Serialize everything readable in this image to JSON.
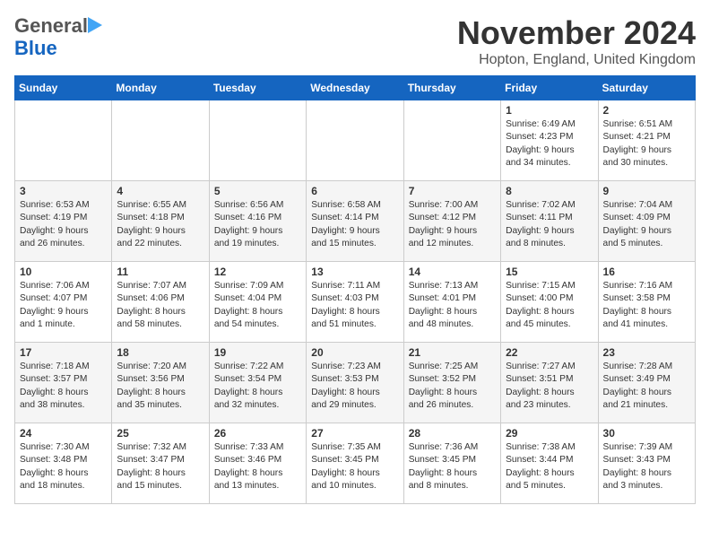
{
  "logo": {
    "general": "General",
    "blue": "Blue"
  },
  "title": "November 2024",
  "location": "Hopton, England, United Kingdom",
  "weekdays": [
    "Sunday",
    "Monday",
    "Tuesday",
    "Wednesday",
    "Thursday",
    "Friday",
    "Saturday"
  ],
  "weeks": [
    [
      {
        "day": "",
        "info": ""
      },
      {
        "day": "",
        "info": ""
      },
      {
        "day": "",
        "info": ""
      },
      {
        "day": "",
        "info": ""
      },
      {
        "day": "",
        "info": ""
      },
      {
        "day": "1",
        "info": "Sunrise: 6:49 AM\nSunset: 4:23 PM\nDaylight: 9 hours\nand 34 minutes."
      },
      {
        "day": "2",
        "info": "Sunrise: 6:51 AM\nSunset: 4:21 PM\nDaylight: 9 hours\nand 30 minutes."
      }
    ],
    [
      {
        "day": "3",
        "info": "Sunrise: 6:53 AM\nSunset: 4:19 PM\nDaylight: 9 hours\nand 26 minutes."
      },
      {
        "day": "4",
        "info": "Sunrise: 6:55 AM\nSunset: 4:18 PM\nDaylight: 9 hours\nand 22 minutes."
      },
      {
        "day": "5",
        "info": "Sunrise: 6:56 AM\nSunset: 4:16 PM\nDaylight: 9 hours\nand 19 minutes."
      },
      {
        "day": "6",
        "info": "Sunrise: 6:58 AM\nSunset: 4:14 PM\nDaylight: 9 hours\nand 15 minutes."
      },
      {
        "day": "7",
        "info": "Sunrise: 7:00 AM\nSunset: 4:12 PM\nDaylight: 9 hours\nand 12 minutes."
      },
      {
        "day": "8",
        "info": "Sunrise: 7:02 AM\nSunset: 4:11 PM\nDaylight: 9 hours\nand 8 minutes."
      },
      {
        "day": "9",
        "info": "Sunrise: 7:04 AM\nSunset: 4:09 PM\nDaylight: 9 hours\nand 5 minutes."
      }
    ],
    [
      {
        "day": "10",
        "info": "Sunrise: 7:06 AM\nSunset: 4:07 PM\nDaylight: 9 hours\nand 1 minute."
      },
      {
        "day": "11",
        "info": "Sunrise: 7:07 AM\nSunset: 4:06 PM\nDaylight: 8 hours\nand 58 minutes."
      },
      {
        "day": "12",
        "info": "Sunrise: 7:09 AM\nSunset: 4:04 PM\nDaylight: 8 hours\nand 54 minutes."
      },
      {
        "day": "13",
        "info": "Sunrise: 7:11 AM\nSunset: 4:03 PM\nDaylight: 8 hours\nand 51 minutes."
      },
      {
        "day": "14",
        "info": "Sunrise: 7:13 AM\nSunset: 4:01 PM\nDaylight: 8 hours\nand 48 minutes."
      },
      {
        "day": "15",
        "info": "Sunrise: 7:15 AM\nSunset: 4:00 PM\nDaylight: 8 hours\nand 45 minutes."
      },
      {
        "day": "16",
        "info": "Sunrise: 7:16 AM\nSunset: 3:58 PM\nDaylight: 8 hours\nand 41 minutes."
      }
    ],
    [
      {
        "day": "17",
        "info": "Sunrise: 7:18 AM\nSunset: 3:57 PM\nDaylight: 8 hours\nand 38 minutes."
      },
      {
        "day": "18",
        "info": "Sunrise: 7:20 AM\nSunset: 3:56 PM\nDaylight: 8 hours\nand 35 minutes."
      },
      {
        "day": "19",
        "info": "Sunrise: 7:22 AM\nSunset: 3:54 PM\nDaylight: 8 hours\nand 32 minutes."
      },
      {
        "day": "20",
        "info": "Sunrise: 7:23 AM\nSunset: 3:53 PM\nDaylight: 8 hours\nand 29 minutes."
      },
      {
        "day": "21",
        "info": "Sunrise: 7:25 AM\nSunset: 3:52 PM\nDaylight: 8 hours\nand 26 minutes."
      },
      {
        "day": "22",
        "info": "Sunrise: 7:27 AM\nSunset: 3:51 PM\nDaylight: 8 hours\nand 23 minutes."
      },
      {
        "day": "23",
        "info": "Sunrise: 7:28 AM\nSunset: 3:49 PM\nDaylight: 8 hours\nand 21 minutes."
      }
    ],
    [
      {
        "day": "24",
        "info": "Sunrise: 7:30 AM\nSunset: 3:48 PM\nDaylight: 8 hours\nand 18 minutes."
      },
      {
        "day": "25",
        "info": "Sunrise: 7:32 AM\nSunset: 3:47 PM\nDaylight: 8 hours\nand 15 minutes."
      },
      {
        "day": "26",
        "info": "Sunrise: 7:33 AM\nSunset: 3:46 PM\nDaylight: 8 hours\nand 13 minutes."
      },
      {
        "day": "27",
        "info": "Sunrise: 7:35 AM\nSunset: 3:45 PM\nDaylight: 8 hours\nand 10 minutes."
      },
      {
        "day": "28",
        "info": "Sunrise: 7:36 AM\nSunset: 3:45 PM\nDaylight: 8 hours\nand 8 minutes."
      },
      {
        "day": "29",
        "info": "Sunrise: 7:38 AM\nSunset: 3:44 PM\nDaylight: 8 hours\nand 5 minutes."
      },
      {
        "day": "30",
        "info": "Sunrise: 7:39 AM\nSunset: 3:43 PM\nDaylight: 8 hours\nand 3 minutes."
      }
    ]
  ]
}
